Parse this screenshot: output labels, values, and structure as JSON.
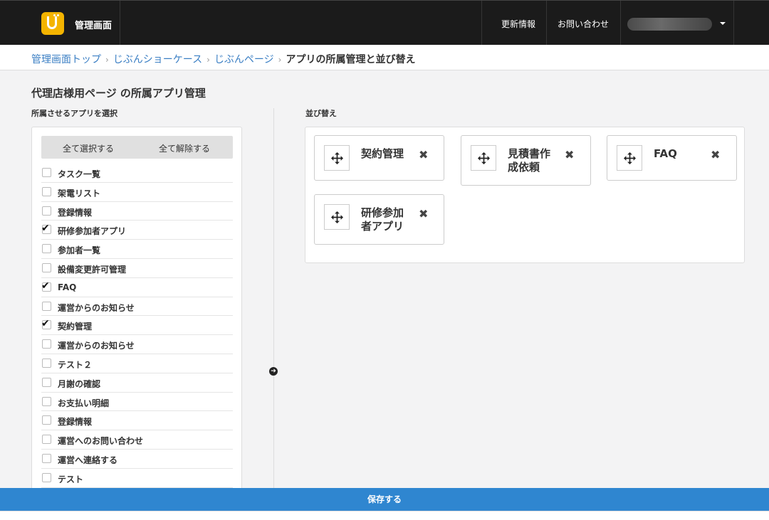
{
  "header": {
    "app_name": "管理画面",
    "nav": [
      "更新情報",
      "お問い合わせ"
    ]
  },
  "breadcrumb": {
    "items": [
      "管理画面トップ",
      "じぶんショーケース",
      "じぶんページ"
    ],
    "separator": "›",
    "current": "アプリの所属管理と並び替え"
  },
  "page": {
    "title": "代理店様用ページ の所属アプリ管理",
    "left_label": "所属させるアプリを選択",
    "right_label": "並び替え"
  },
  "select_all_label": "全て選択する",
  "deselect_all_label": "全て解除する",
  "apps": [
    {
      "label": "タスク一覧",
      "checked": false
    },
    {
      "label": "架電リスト",
      "checked": false
    },
    {
      "label": "登録情報",
      "checked": false
    },
    {
      "label": "研修参加者アプリ",
      "checked": true
    },
    {
      "label": "参加者一覧",
      "checked": false
    },
    {
      "label": "設備変更許可管理",
      "checked": false
    },
    {
      "label": "FAQ",
      "checked": true
    },
    {
      "label": "運営からのお知らせ",
      "checked": false
    },
    {
      "label": "契約管理",
      "checked": true
    },
    {
      "label": "運営からのお知らせ",
      "checked": false
    },
    {
      "label": "テスト２",
      "checked": false
    },
    {
      "label": "月謝の確認",
      "checked": false
    },
    {
      "label": "お支払い明細",
      "checked": false
    },
    {
      "label": "登録情報",
      "checked": false
    },
    {
      "label": "運営へのお問い合わせ",
      "checked": false
    },
    {
      "label": "運営へ連絡する",
      "checked": false
    },
    {
      "label": "テスト",
      "checked": false
    }
  ],
  "sorted": [
    {
      "line1": "契約管理",
      "line2": ""
    },
    {
      "line1": "見積書作",
      "line2": "成依頼"
    },
    {
      "line1": "FAQ",
      "line2": ""
    },
    {
      "line1": "研修参加",
      "line2": "者アプリ"
    }
  ],
  "icons": {
    "move": "move-arrows-icon",
    "remove": "close-x-icon",
    "arrow": "arrow-right-circle-icon"
  },
  "check_mark": "✔",
  "remove_glyph": "✖",
  "arrow_glyph": "➔",
  "save_label": "保存する",
  "colors": {
    "header_bg": "#1b1b1b",
    "logo": "#f4b400",
    "link": "#3b7fc4",
    "save_bar": "#2f86d0"
  }
}
